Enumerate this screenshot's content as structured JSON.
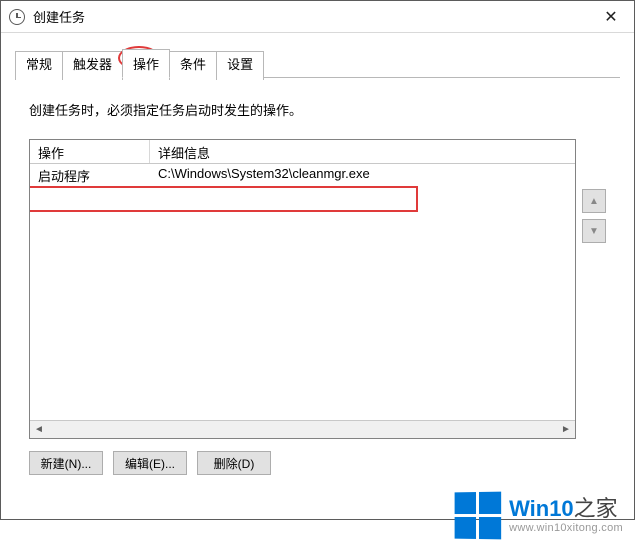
{
  "title": "创建任务",
  "tabs": {
    "general": "常规",
    "triggers": "触发器",
    "actions": "操作",
    "conditions": "条件",
    "settings": "设置"
  },
  "activeTab": "actions",
  "description": "创建任务时，必须指定任务启动时发生的操作。",
  "columns": {
    "action": "操作",
    "details": "详细信息"
  },
  "rows": [
    {
      "action": "启动程序",
      "details": "C:\\Windows\\System32\\cleanmgr.exe"
    }
  ],
  "buttons": {
    "new": "新建(N)...",
    "edit": "编辑(E)...",
    "delete": "删除(D)"
  },
  "watermark": {
    "brand_prefix": "Win10",
    "brand_suffix": "之家",
    "url": "www.win10xitong.com"
  }
}
